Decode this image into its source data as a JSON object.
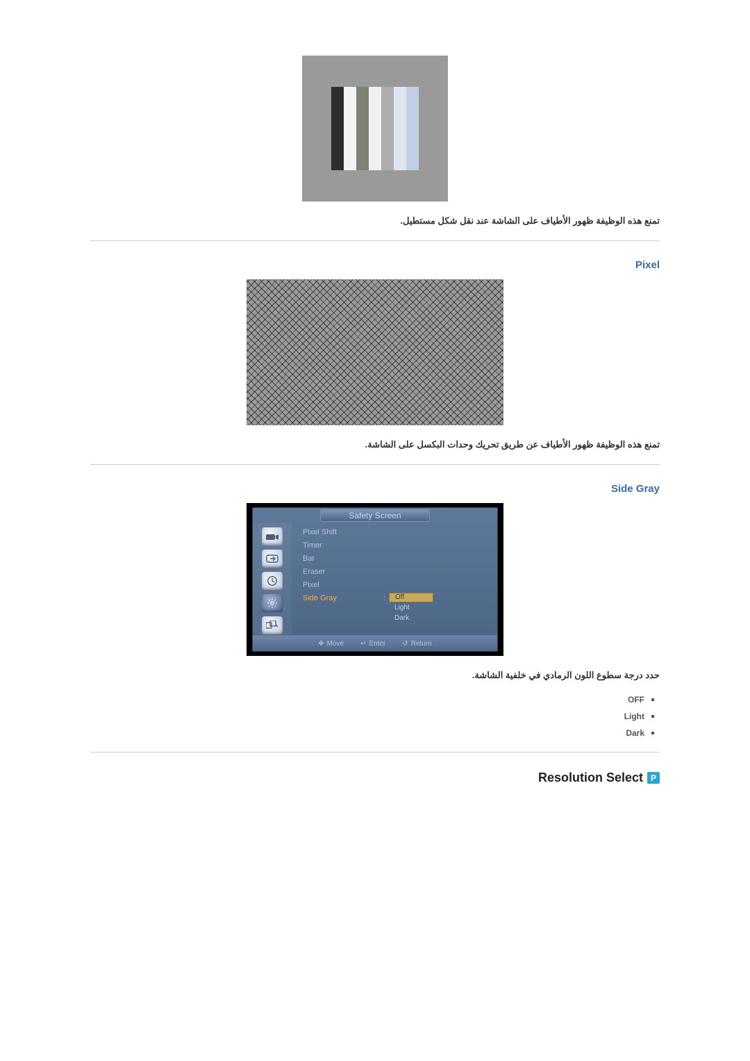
{
  "bar_section": {
    "description": "تمنع هذه الوظيفة ظهور الأطياف على الشاشة عند نقل شكل مستطيل.",
    "bar_colors": [
      "#2e2e2e",
      "#f3f3f3",
      "#7d8476",
      "#f0f0f0",
      "#adadad",
      "#e0e6ef",
      "#c2cee1"
    ]
  },
  "pixel_section": {
    "title": "Pixel",
    "description": "تمنع هذه الوظيفة ظهور الأطياف عن طريق تحريك وحدات البكسل على الشاشة."
  },
  "sidegray_section": {
    "title": "Side Gray",
    "description": "حدد درجة سطوع اللون الرمادي في خلفية الشاشة.",
    "options": [
      "OFF",
      "Light",
      "Dark"
    ]
  },
  "osd": {
    "title": "Safety Screen",
    "menu": [
      "Pixel Shift",
      "Timer",
      "Bar",
      "Eraser",
      "Pixel",
      "Side Gray"
    ],
    "selected_menu_index": 5,
    "values": [
      "Off",
      "Light",
      "Dark"
    ],
    "selected_value_index": 0,
    "footer": {
      "move": "Move",
      "enter": "Enter",
      "return": "Return"
    }
  },
  "resolution_select": {
    "badge": "P",
    "title": "Resolution Select"
  }
}
